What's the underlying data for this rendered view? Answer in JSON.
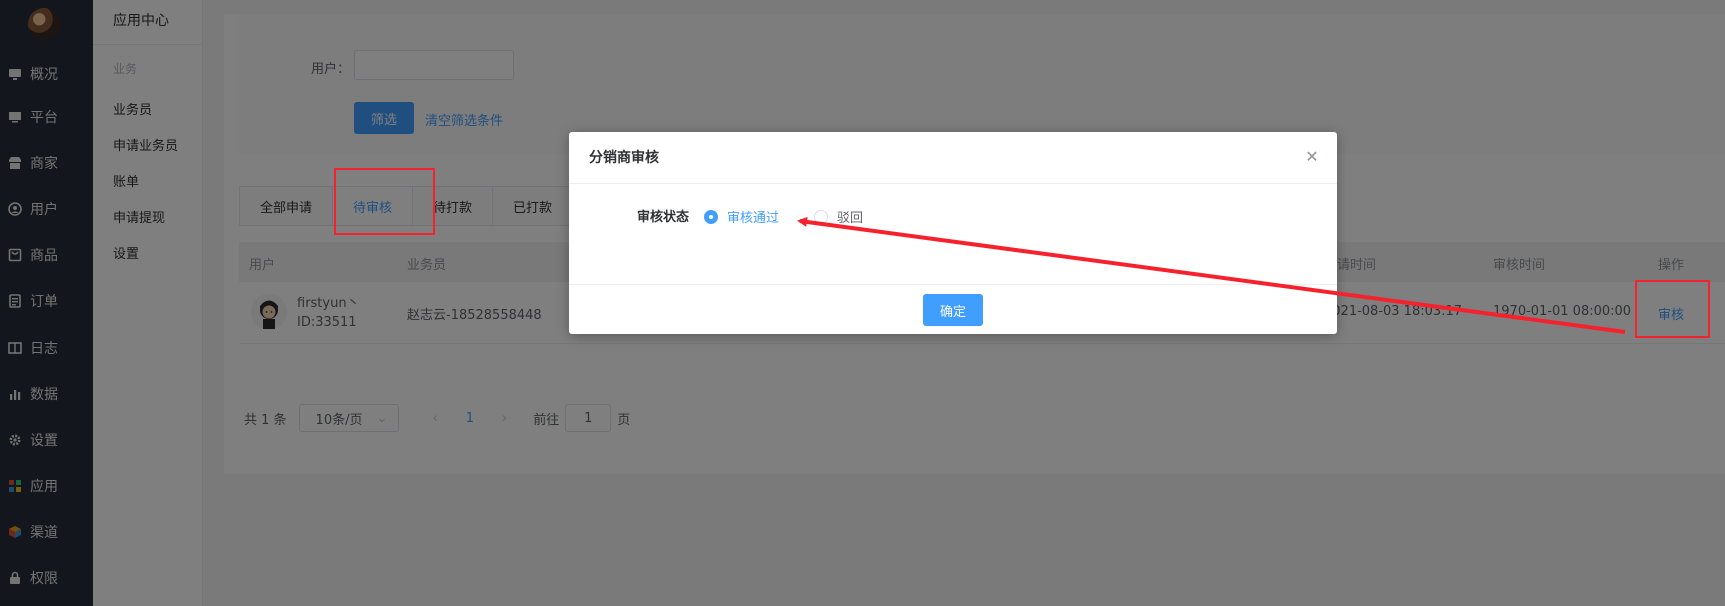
{
  "nav": {
    "items": [
      {
        "label": "概况",
        "icon": "monitor-icon"
      },
      {
        "label": "平台",
        "icon": "desktop-icon"
      },
      {
        "label": "商家",
        "icon": "store-icon"
      },
      {
        "label": "用户",
        "icon": "user-icon"
      },
      {
        "label": "商品",
        "icon": "goods-icon"
      },
      {
        "label": "订单",
        "icon": "order-icon"
      },
      {
        "label": "日志",
        "icon": "log-icon"
      },
      {
        "label": "数据",
        "icon": "chart-icon"
      },
      {
        "label": "设置",
        "icon": "gear-icon"
      },
      {
        "label": "应用",
        "icon": "apps-icon"
      },
      {
        "label": "渠道",
        "icon": "cube-icon"
      },
      {
        "label": "权限",
        "icon": "lock-icon"
      }
    ]
  },
  "submenu": {
    "title": "应用中心",
    "group": "业务",
    "items": [
      "业务员",
      "申请业务员",
      "账单",
      "申请提现",
      "设置"
    ]
  },
  "filter": {
    "user_label": "用户：",
    "user_value": "",
    "filter_button": "筛选",
    "clear_link": "清空筛选条件"
  },
  "tabs": [
    "全部申请",
    "待审核",
    "待打款",
    "已打款"
  ],
  "table": {
    "headers": {
      "user": "用户",
      "salesman": "业务员",
      "apply_time": "申请时间",
      "review_time": "审核时间",
      "action": "操作"
    },
    "rows": [
      {
        "name": "firstyun丶",
        "id": "ID:33511",
        "salesman": "赵志云-18528558448",
        "apply_time": "2021-08-03 18:03:17",
        "review_time": "1970-01-01 08:00:00",
        "action": "审核"
      }
    ]
  },
  "pagination": {
    "total": "共 1 条",
    "page_size": "10条/页",
    "current": "1",
    "goto_label": "前往",
    "goto_value": "1",
    "page_suffix": "页"
  },
  "modal": {
    "title": "分销商审核",
    "field_label": "审核状态",
    "options": [
      {
        "label": "审核通过",
        "selected": true
      },
      {
        "label": "驳回",
        "selected": false
      }
    ],
    "confirm": "确定"
  },
  "colors": {
    "accent": "#409eff",
    "nav_bg": "#262c38",
    "annotation": "#f5222d"
  }
}
